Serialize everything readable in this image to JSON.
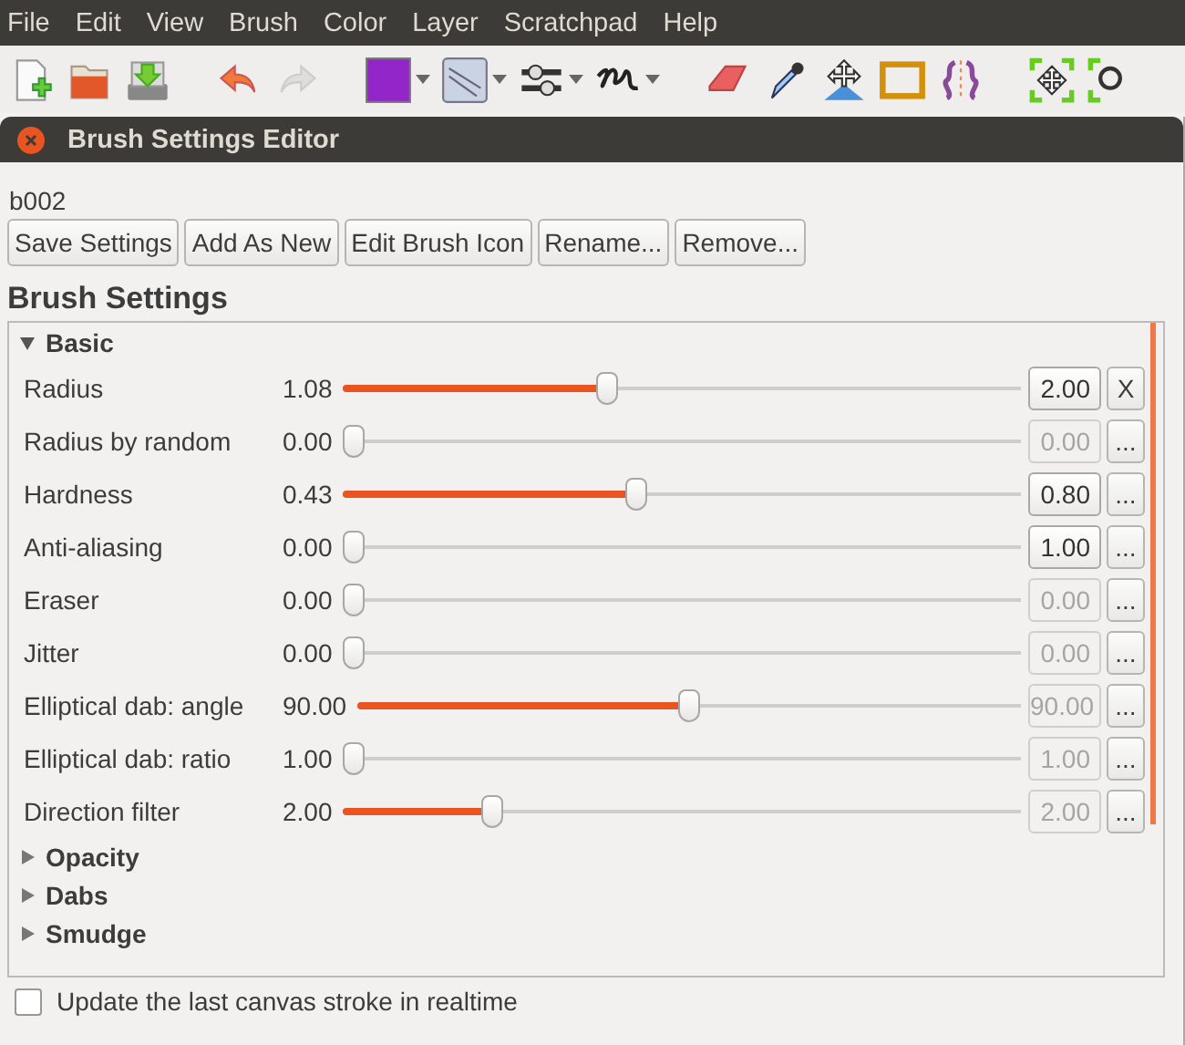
{
  "menu": [
    "File",
    "Edit",
    "View",
    "Brush",
    "Color",
    "Layer",
    "Scratchpad",
    "Help"
  ],
  "dialog": {
    "title": "Brush Settings Editor"
  },
  "brush_name": "b002",
  "actions": [
    "Save Settings",
    "Add As New",
    "Edit Brush Icon",
    "Rename...",
    "Remove..."
  ],
  "section_title": "Brush Settings",
  "groups": [
    {
      "label": "Basic",
      "expanded": true,
      "settings": [
        {
          "name": "Radius",
          "value": "1.08",
          "level": 0.386,
          "base": "2.00",
          "disabled": false,
          "button": "X"
        },
        {
          "name": "Radius by random",
          "value": "0.00",
          "level": 0,
          "base": "0.00",
          "disabled": true,
          "button": "..."
        },
        {
          "name": "Hardness",
          "value": "0.43",
          "level": 0.43,
          "base": "0.80",
          "disabled": false,
          "button": "..."
        },
        {
          "name": "Anti-aliasing",
          "value": "0.00",
          "level": 0,
          "base": "1.00",
          "disabled": false,
          "button": "..."
        },
        {
          "name": "Eraser",
          "value": "0.00",
          "level": 0,
          "base": "0.00",
          "disabled": true,
          "button": "..."
        },
        {
          "name": "Jitter",
          "value": "0.00",
          "level": 0,
          "base": "0.00",
          "disabled": true,
          "button": "..."
        },
        {
          "name": "Elliptical dab: angle",
          "value": "90.00",
          "level": 0.5,
          "base": "90.00",
          "disabled": true,
          "button": "..."
        },
        {
          "name": "Elliptical dab: ratio",
          "value": "1.00",
          "level": 0,
          "base": "1.00",
          "disabled": true,
          "button": "..."
        },
        {
          "name": "Direction filter",
          "value": "2.00",
          "level": 0.21,
          "base": "2.00",
          "disabled": true,
          "button": "..."
        }
      ]
    },
    {
      "label": "Opacity",
      "expanded": false
    },
    {
      "label": "Dabs",
      "expanded": false
    },
    {
      "label": "Smudge",
      "expanded": false
    }
  ],
  "realtime_checkbox": {
    "label": "Update the last canvas stroke in realtime",
    "checked": false
  }
}
